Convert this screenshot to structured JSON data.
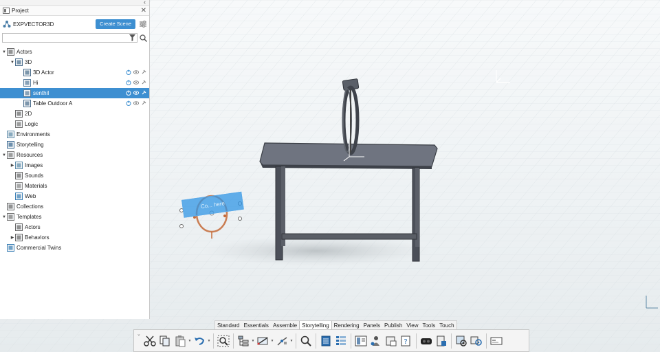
{
  "panel": {
    "title": "Project",
    "close_label": "✕",
    "collapse_label": "‹",
    "project_name": "EXPVECTOR3D",
    "create_scene_label": "Create Scene",
    "search_placeholder": ""
  },
  "tree": [
    {
      "label": "Actors",
      "level": 0,
      "expanded": true,
      "icon": "actor-icon"
    },
    {
      "label": "3D",
      "level": 1,
      "expanded": true,
      "icon": "3d-icon"
    },
    {
      "label": "3D Actor",
      "level": 2,
      "icon": "3d-actor-icon"
    },
    {
      "label": "Hi",
      "level": 2,
      "icon": "text-actor-icon"
    },
    {
      "label": "senthil",
      "level": 2,
      "icon": "label-actor-icon",
      "selected": true
    },
    {
      "label": "Table Outdoor A",
      "level": 2,
      "icon": "model-icon"
    },
    {
      "label": "2D",
      "level": 1,
      "icon": "2d-icon"
    },
    {
      "label": "Logic",
      "level": 1,
      "icon": "logic-icon"
    },
    {
      "label": "Environments",
      "level": 0,
      "icon": "environment-icon"
    },
    {
      "label": "Storytelling",
      "level": 0,
      "icon": "storytelling-icon"
    },
    {
      "label": "Resources",
      "level": 0,
      "expanded": true,
      "icon": "resources-icon"
    },
    {
      "label": "Images",
      "level": 1,
      "collapsed": true,
      "icon": "images-icon"
    },
    {
      "label": "Sounds",
      "level": 1,
      "icon": "sounds-icon"
    },
    {
      "label": "Materials",
      "level": 1,
      "icon": "materials-icon"
    },
    {
      "label": "Web",
      "level": 1,
      "icon": "web-icon"
    },
    {
      "label": "Collections",
      "level": 0,
      "icon": "collections-icon"
    },
    {
      "label": "Templates",
      "level": 0,
      "expanded": true,
      "icon": "templates-icon"
    },
    {
      "label": "Actors",
      "level": 1,
      "icon": "actor-template-icon"
    },
    {
      "label": "Behaviors",
      "level": 1,
      "collapsed": true,
      "icon": "behaviors-icon"
    },
    {
      "label": "Commercial Twins",
      "level": 0,
      "icon": "commercial-twins-icon"
    }
  ],
  "tabs": [
    "Standard",
    "Essentials",
    "Assemble",
    "Storytelling",
    "Rendering",
    "Panels",
    "Publish",
    "View",
    "Tools",
    "Touch"
  ],
  "active_tab": "Storytelling",
  "floating_label_text": "Co... here",
  "colors": {
    "accent": "#3d8fd1",
    "selection": "#3d8fd1",
    "table": "#4a4f5a"
  }
}
